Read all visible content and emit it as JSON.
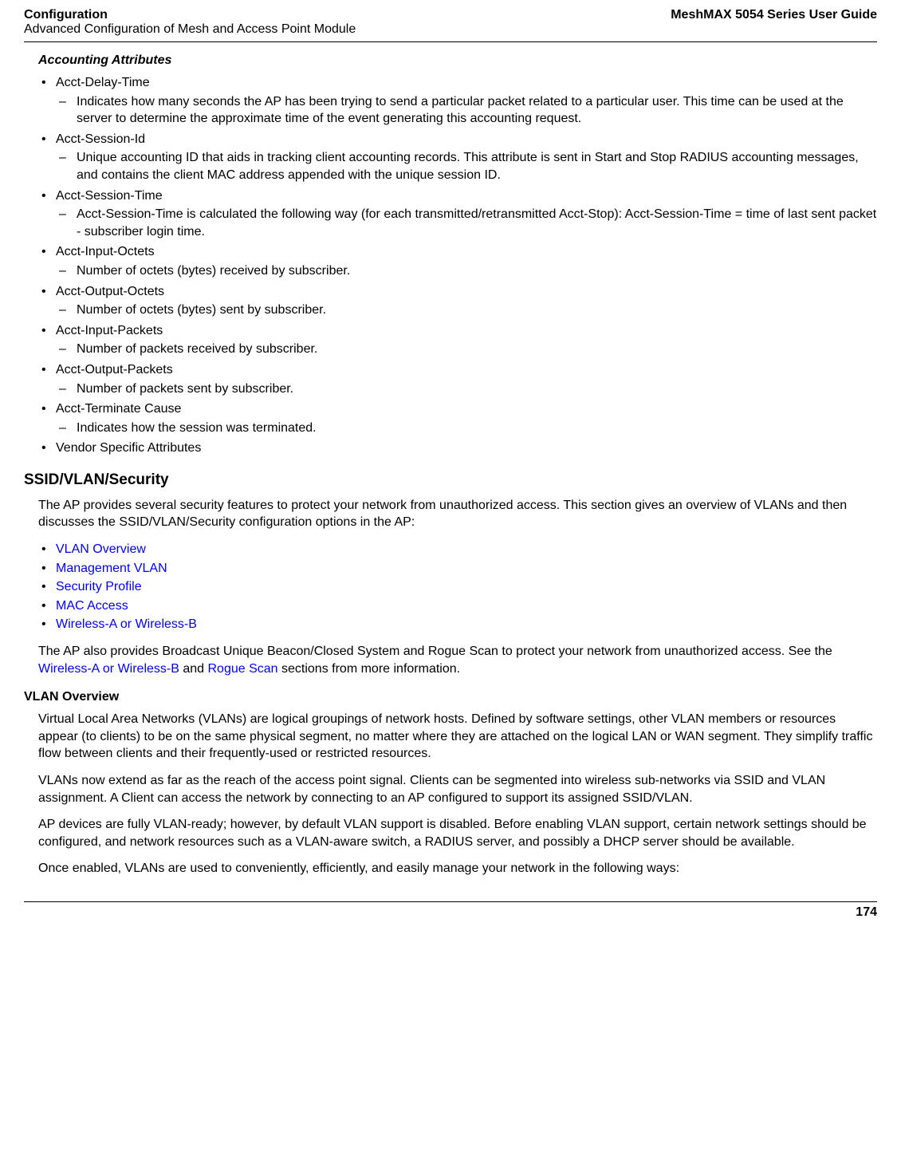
{
  "header": {
    "left_top": "Configuration",
    "left_bottom": "Advanced Configuration of Mesh and Access Point Module",
    "right": "MeshMAX 5054 Series User Guide"
  },
  "accounting": {
    "heading": "Accounting Attributes",
    "items": [
      {
        "label": "Acct-Delay-Time",
        "subs": [
          "Indicates how many seconds the AP has been trying to send a particular packet related to a particular user. This time can be used at the server to determine the approximate time of the event generating this accounting request."
        ]
      },
      {
        "label": "Acct-Session-Id",
        "subs": [
          "Unique accounting ID that aids in tracking client accounting records. This attribute is sent in Start and Stop RADIUS accounting messages, and contains the client MAC address appended with the unique session ID."
        ]
      },
      {
        "label": "Acct-Session-Time",
        "subs": [
          "Acct-Session-Time is calculated the following way (for each transmitted/retransmitted Acct-Stop): Acct-Session-Time = time of last sent packet - subscriber login time."
        ]
      },
      {
        "label": "Acct-Input-Octets",
        "subs": [
          "Number of octets (bytes) received by subscriber."
        ]
      },
      {
        "label": "Acct-Output-Octets",
        "subs": [
          "Number of octets (bytes) sent by subscriber."
        ]
      },
      {
        "label": "Acct-Input-Packets",
        "subs": [
          "Number of packets received by subscriber."
        ]
      },
      {
        "label": "Acct-Output-Packets",
        "subs": [
          "Number of packets sent by subscriber."
        ]
      },
      {
        "label": "Acct-Terminate Cause",
        "subs": [
          "Indicates how the session was terminated."
        ]
      },
      {
        "label": "Vendor Specific Attributes",
        "subs": []
      }
    ]
  },
  "ssid": {
    "heading": "SSID/VLAN/Security",
    "intro": "The AP provides several security features to protect your network from unauthorized access. This section gives an overview of VLANs and then discusses the SSID/VLAN/Security configuration options in the AP:",
    "links": [
      "VLAN Overview",
      "Management VLAN",
      "Security Profile",
      "MAC Access",
      "Wireless-A or Wireless-B"
    ],
    "note_pre": "The AP also provides Broadcast Unique Beacon/Closed System and Rogue Scan to protect your network from unauthorized access. See the ",
    "note_link1": "Wireless-A or Wireless-B",
    "note_mid": " and ",
    "note_link2": "Rogue Scan",
    "note_post": " sections from more information."
  },
  "vlan": {
    "heading": "VLAN Overview",
    "p1": "Virtual Local Area Networks (VLANs) are logical groupings of network hosts. Defined by software settings, other VLAN members or resources appear (to clients) to be on the same physical segment, no matter where they are attached on the logical LAN or WAN segment. They simplify traffic flow between clients and their frequently-used or restricted resources.",
    "p2": "VLANs now extend as far as the reach of the access point signal. Clients can be segmented into wireless sub-networks via SSID and VLAN assignment. A Client can access the network by connecting to an AP configured to support its assigned SSID/VLAN.",
    "p3": "AP devices are fully VLAN-ready; however, by default VLAN support is disabled. Before enabling VLAN support, certain network settings should be configured, and network resources such as a VLAN-aware switch, a RADIUS server, and possibly a DHCP server should be available.",
    "p4": "Once enabled, VLANs are used to conveniently, efficiently, and easily manage your network in the following ways:"
  },
  "footer": {
    "page": "174"
  }
}
